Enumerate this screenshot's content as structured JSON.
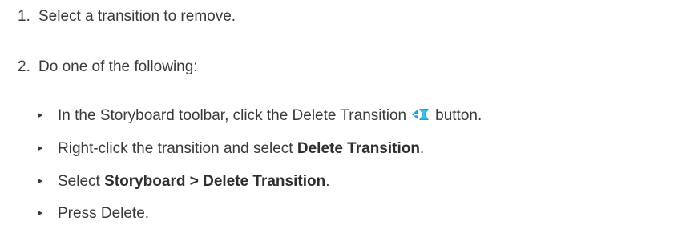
{
  "steps": [
    {
      "number": "1.",
      "text": "Select a transition to remove."
    },
    {
      "number": "2.",
      "text": "Do one of the following:"
    }
  ],
  "bullets": {
    "marker": "▸",
    "item1": {
      "before": "In the Storyboard toolbar, click the Delete Transition",
      "icon": "delete-transition-icon",
      "after": "button."
    },
    "item2": {
      "before": "Right-click the transition and select ",
      "bold": "Delete Transition",
      "after": "."
    },
    "item3": {
      "before": "Select ",
      "bold": "Storyboard > Delete Transition",
      "after": "."
    },
    "item4": {
      "text": "Press Delete."
    }
  },
  "colors": {
    "text": "#3a3a3a",
    "icon_blue": "#1fa3e0",
    "icon_cyan": "#35c3e8"
  }
}
